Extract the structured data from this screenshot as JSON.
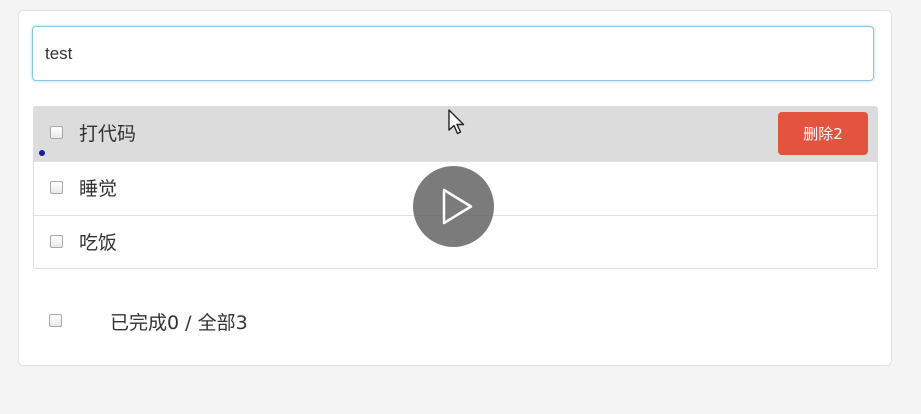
{
  "input": {
    "value": "test",
    "placeholder": ""
  },
  "todos": [
    {
      "label": "打代码",
      "checked": false
    },
    {
      "label": "睡觉",
      "checked": false
    },
    {
      "label": "吃饭",
      "checked": false
    }
  ],
  "row_hover": {
    "delete_label": "删除2"
  },
  "footer": {
    "done_label": "已完成",
    "done_count": "0",
    "separator": " / ",
    "all_label": "全部",
    "all_count": "3"
  },
  "overlay": {
    "icon": "play-icon"
  },
  "colors": {
    "delete_button": "#e2543d",
    "hover_row": "#dcdcdc",
    "input_focus_border": "#8ec4e6"
  }
}
